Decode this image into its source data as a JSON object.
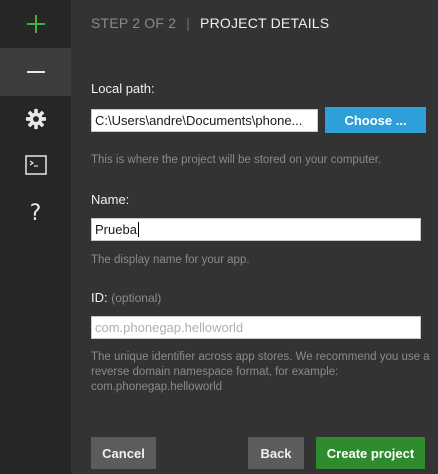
{
  "header": {
    "step": "STEP 2 OF 2",
    "separator": "|",
    "title": "PROJECT DETAILS"
  },
  "sidebar": {
    "items": [
      {
        "icon": "plus-icon",
        "active": false
      },
      {
        "icon": "minus-icon",
        "active": true
      },
      {
        "icon": "gear-icon",
        "active": false
      },
      {
        "icon": "terminal-icon",
        "active": false
      },
      {
        "icon": "help-icon",
        "active": false
      }
    ]
  },
  "form": {
    "local_path": {
      "label": "Local path:",
      "value": "C:\\Users\\andre\\Documents\\phone...",
      "button": "Choose ...",
      "help": "This is where the project will be stored on your computer."
    },
    "name": {
      "label": "Name:",
      "value": "Prueba",
      "help": "The display name for your app."
    },
    "id": {
      "label": "ID:",
      "optional": "(optional)",
      "placeholder": "com.phonegap.helloworld",
      "help": "The unique identifier across app stores. We recommend you use a reverse domain namespace format, for example: com.phonegap.helloworld"
    }
  },
  "footer": {
    "cancel": "Cancel",
    "back": "Back",
    "create": "Create project"
  },
  "colors": {
    "accent_blue": "#2d9fd9",
    "create_green": "#2e8b2e",
    "plus_green": "#3cb043"
  }
}
